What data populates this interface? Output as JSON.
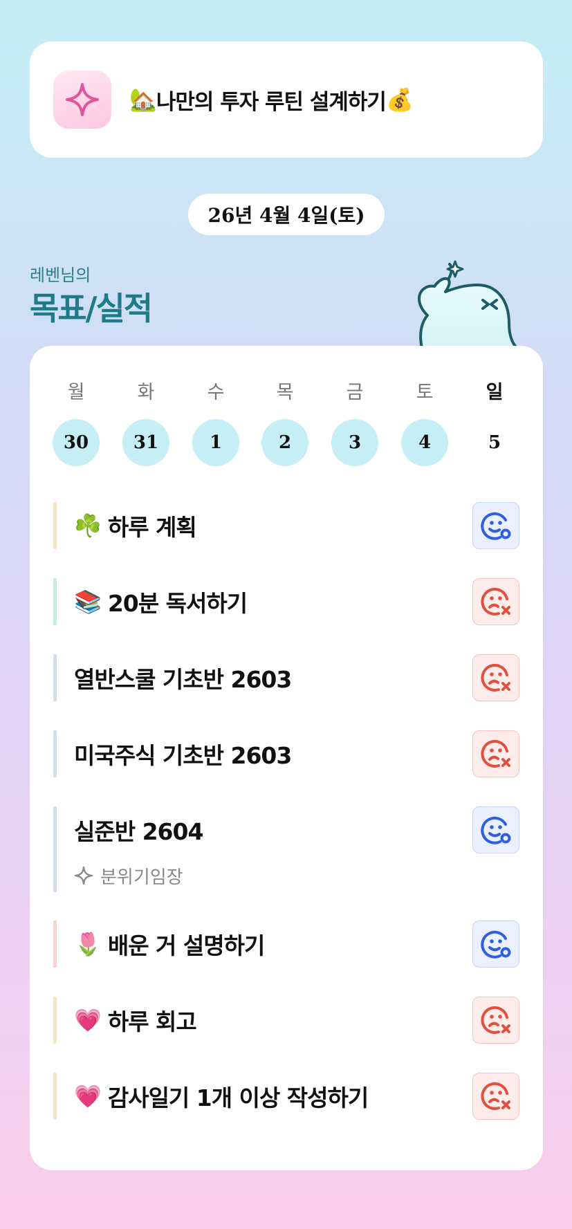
{
  "header": {
    "emoji_left": "🏡",
    "title": "나만의 투자 루틴 설계하기",
    "emoji_right": "💰",
    "icon": "sparkle-icon"
  },
  "date": "26년 4월 4일(토)",
  "section": {
    "subtitle": "레벤님의",
    "title": "목표/실적"
  },
  "week": [
    {
      "label": "월",
      "num": "30",
      "filled": true
    },
    {
      "label": "화",
      "num": "31",
      "filled": true
    },
    {
      "label": "수",
      "num": "1",
      "filled": true
    },
    {
      "label": "목",
      "num": "2",
      "filled": true
    },
    {
      "label": "금",
      "num": "3",
      "filled": true
    },
    {
      "label": "토",
      "num": "4",
      "filled": true
    },
    {
      "label": "일",
      "num": "5",
      "filled": false
    }
  ],
  "tasks": [
    {
      "emoji": "☘️",
      "name": "하루 계획",
      "status": "done",
      "bar_color": "#fde2c0"
    },
    {
      "emoji": "📚",
      "name": "20분 독서하기",
      "status": "fail",
      "bar_color": "#bfeedd"
    },
    {
      "emoji": "",
      "name": "열반스쿨 기초반 2603",
      "status": "fail",
      "bar_color": "#cfdcf7"
    },
    {
      "emoji": "",
      "name": "미국주식 기초반 2603",
      "status": "fail",
      "bar_color": "#cfdcf7"
    },
    {
      "emoji": "",
      "name": "실준반 2604",
      "status": "done",
      "bar_color": "#cfdcf7",
      "sub": "분위기임장"
    },
    {
      "emoji": "🌷",
      "name": "배운 거 설명하기",
      "status": "done",
      "bar_color": "#fdd0c8"
    },
    {
      "emoji": "💗",
      "name": "하루 회고",
      "status": "fail",
      "bar_color": "#fde2c0"
    },
    {
      "emoji": "💗",
      "name": "감사일기 1개 이상 작성하기",
      "status": "fail",
      "bar_color": "#fde2c0"
    }
  ],
  "colors": {
    "done": "#2f5fe0",
    "fail": "#e0503f",
    "title_teal": "#1e7b87"
  }
}
